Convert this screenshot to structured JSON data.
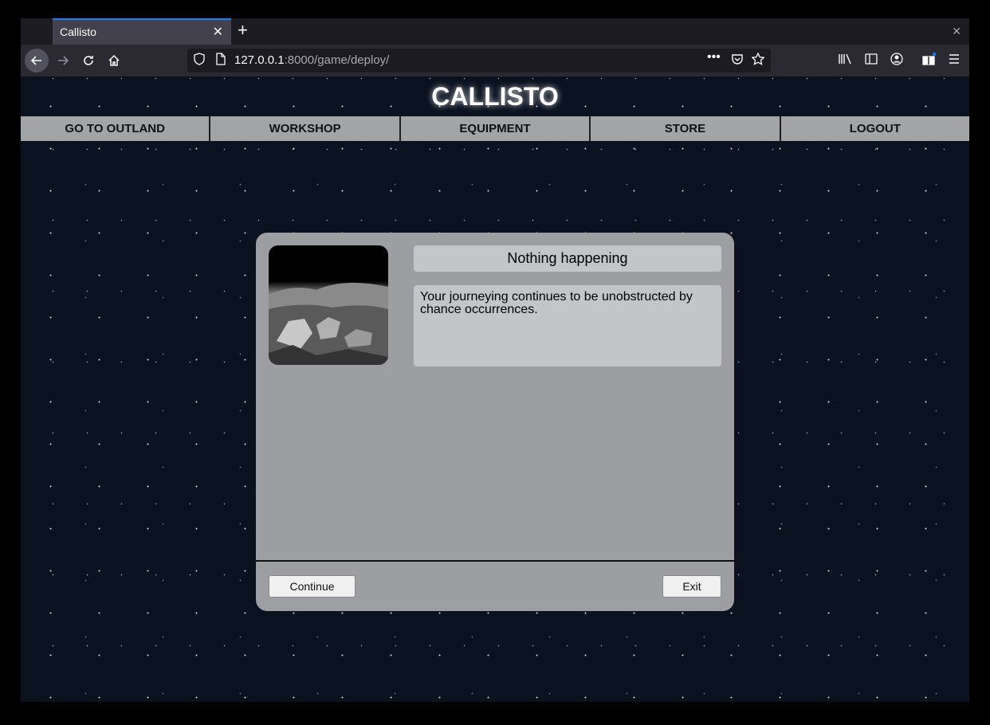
{
  "browser": {
    "tab_title": "Callisto",
    "tab_close": "✕",
    "new_tab": "+",
    "window_close": "✕",
    "url_host": "127.0.0.1",
    "url_rest": ":8000/game/deploy/"
  },
  "site": {
    "title": "CALLISTO",
    "menu": [
      "GO TO OUTLAND",
      "WORKSHOP",
      "EQUIPMENT",
      "STORE",
      "LOGOUT"
    ]
  },
  "event": {
    "title": "Nothing happening",
    "description": "Your journeying continues to be unobstructed by chance occurrences.",
    "image": "lunar-landscape"
  },
  "buttons": {
    "continue": "Continue",
    "exit": "Exit"
  }
}
